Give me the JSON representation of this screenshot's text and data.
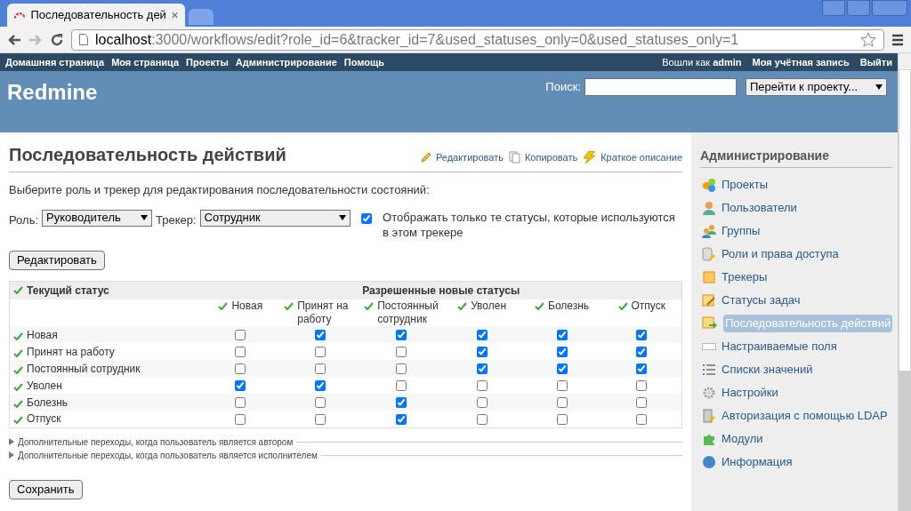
{
  "browser": {
    "tab_title": "Последовательность дей",
    "url_host": "localhost",
    "url_rest": ":3000/workflows/edit?role_id=6&tracker_id=7&used_statuses_only=0&used_statuses_only=1"
  },
  "top_menu": {
    "left": [
      "Домашняя страница",
      "Моя страница",
      "Проекты",
      "Администрирование",
      "Помощь"
    ],
    "logged_in_label": "Вошли как",
    "logged_in_user": "admin",
    "right": [
      "Моя учётная запись",
      "Выйти"
    ]
  },
  "header": {
    "title": "Redmine",
    "search_label": "Поиск:",
    "project_jump": "Перейти к проекту..."
  },
  "page": {
    "title": "Последовательность действий",
    "actions": [
      {
        "kind": "edit",
        "label": "Редактировать"
      },
      {
        "kind": "copy",
        "label": "Копировать"
      },
      {
        "kind": "summary",
        "label": "Краткое описание"
      }
    ],
    "intro": "Выберите роль и трекер для редактирования последовательности состояний:",
    "role_label": "Роль:",
    "role_value": "Руководитель",
    "tracker_label": "Трекер:",
    "tracker_value": "Сотрудник",
    "used_only": {
      "label": "Отображать только те статусы, которые используются в этом трекере",
      "checked": true
    },
    "edit_button": "Редактировать"
  },
  "matrix": {
    "current_header": "Текущий статус",
    "new_header": "Разрешенные новые статусы",
    "columns": [
      "Новая",
      "Принят на работу",
      "Постоянный сотрудник",
      "Уволен",
      "Болезнь",
      "Отпуск"
    ],
    "rows": [
      {
        "status": "Новая",
        "allowed": [
          false,
          true,
          true,
          true,
          true,
          true
        ]
      },
      {
        "status": "Принят на работу",
        "allowed": [
          false,
          false,
          false,
          true,
          true,
          true
        ]
      },
      {
        "status": "Постоянный сотрудник",
        "allowed": [
          false,
          false,
          false,
          true,
          true,
          true
        ]
      },
      {
        "status": "Уволен",
        "allowed": [
          true,
          true,
          false,
          false,
          false,
          false
        ]
      },
      {
        "status": "Болезнь",
        "allowed": [
          false,
          false,
          true,
          false,
          false,
          false
        ]
      },
      {
        "status": "Отпуск",
        "allowed": [
          false,
          false,
          true,
          false,
          false,
          false
        ]
      }
    ]
  },
  "extra_sections": [
    {
      "label": "Дополнительные переходы, когда пользователь является автором",
      "expanded": false
    },
    {
      "label": "Дополнительные переходы, когда пользователь является исполнителем",
      "expanded": false
    }
  ],
  "save_button": "Сохранить",
  "sidebar": {
    "title": "Администрирование",
    "items": [
      {
        "kind": "projects",
        "label": "Проекты",
        "selected": false
      },
      {
        "kind": "users",
        "label": "Пользователи",
        "selected": false
      },
      {
        "kind": "groups",
        "label": "Группы",
        "selected": false
      },
      {
        "kind": "roles",
        "label": "Роли и права доступа",
        "selected": false
      },
      {
        "kind": "trackers",
        "label": "Трекеры",
        "selected": false
      },
      {
        "kind": "statuses",
        "label": "Статусы задач",
        "selected": false
      },
      {
        "kind": "workflows",
        "label": "Последовательность действий",
        "selected": true
      },
      {
        "kind": "fields",
        "label": "Настраиваемые поля",
        "selected": false
      },
      {
        "kind": "enums",
        "label": "Списки значений",
        "selected": false
      },
      {
        "kind": "settings",
        "label": "Настройки",
        "selected": false
      },
      {
        "kind": "ldap",
        "label": "Авторизация с помощью LDAP",
        "selected": false
      },
      {
        "kind": "plugins",
        "label": "Модули",
        "selected": false
      },
      {
        "kind": "info",
        "label": "Информация",
        "selected": false
      }
    ]
  }
}
